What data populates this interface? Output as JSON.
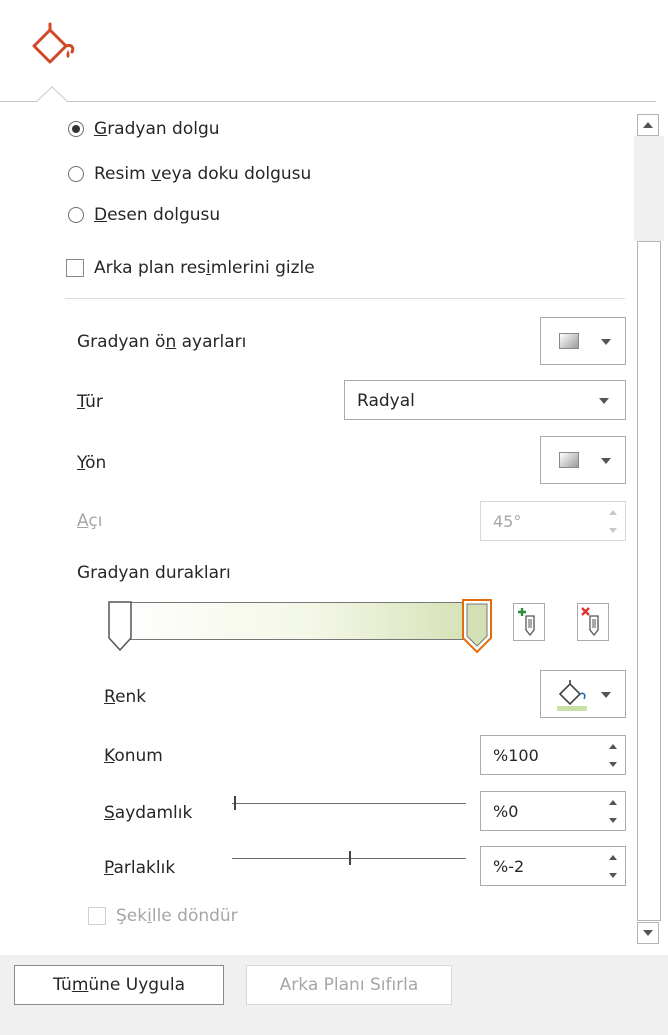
{
  "header": {
    "icon": "paint-bucket-icon"
  },
  "fill_options": {
    "gradient_fill": {
      "pre": "",
      "key": "G",
      "post": "radyan dolgu",
      "selected": true
    },
    "picture_fill": {
      "pre": "Resim ",
      "key": "v",
      "post": "eya doku dolgusu",
      "selected": false
    },
    "pattern_fill": {
      "pre": "",
      "key": "D",
      "post": "esen dolgusu",
      "selected": false
    },
    "hide_bg": {
      "pre": "Arka plan res",
      "key": "i",
      "post": "mlerini gizle",
      "checked": false
    }
  },
  "gradient": {
    "presets": {
      "pre": "Gradyan ö",
      "key": "n",
      "post": " ayarları"
    },
    "type": {
      "pre": "",
      "key": "T",
      "post": "ür",
      "value": "Radyal"
    },
    "direction": {
      "pre": "",
      "key": "Y",
      "post": "ön"
    },
    "angle": {
      "pre": "",
      "key": "A",
      "post": "çı",
      "value": "45°",
      "enabled": false
    },
    "stops_label": "Gradyan durakları",
    "color": {
      "pre": "",
      "key": "R",
      "post": "enk",
      "swatch_color": "#c8dfa5"
    },
    "position": {
      "pre": "",
      "key": "K",
      "post": "onum",
      "value": "%100"
    },
    "transparency": {
      "pre": "",
      "key": "S",
      "post": "aydamlık",
      "value": "%0",
      "level": 0
    },
    "brightness": {
      "pre": "",
      "key": "P",
      "post": "arlaklık",
      "value": "%-2",
      "level": -0.02
    },
    "rotate_with_shape": {
      "pre": "Şek",
      "key": "i",
      "post": "lle döndür",
      "checked": false,
      "enabled": false
    }
  },
  "buttons": {
    "apply_all": {
      "pre": "Tü",
      "key": "m",
      "post": "üne Uygula"
    },
    "reset_bg": "Arka Planı Sıfırla"
  },
  "colors": {
    "accent_orange": "#e46c0a",
    "stop_selected": "#e46c0a",
    "bar_end": "#d3e0b3"
  }
}
